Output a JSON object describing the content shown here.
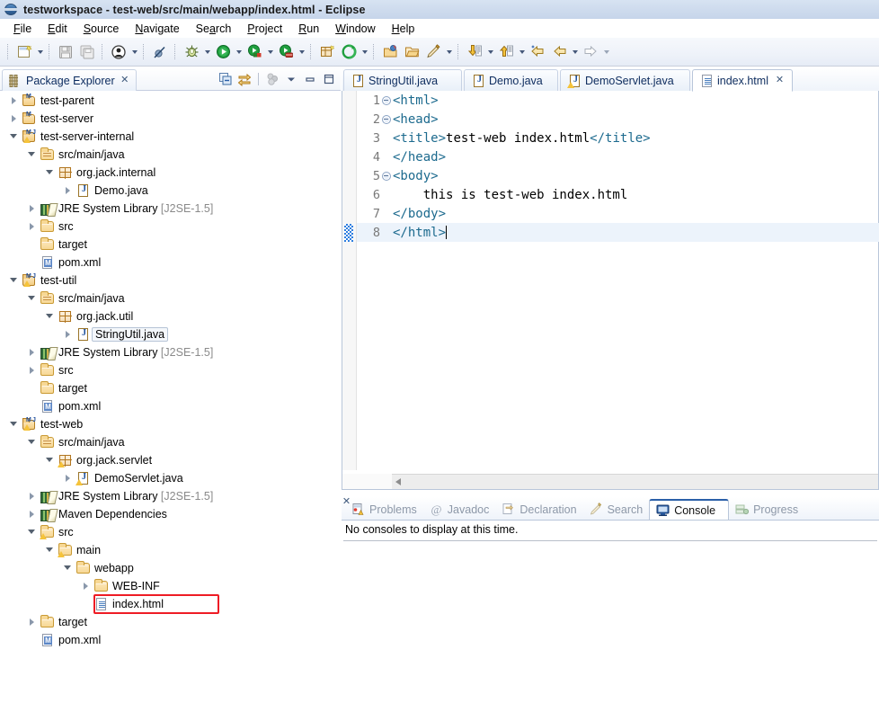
{
  "window": {
    "title": "testworkspace - test-web/src/main/webapp/index.html - Eclipse",
    "icon": "eclipse-globe-icon"
  },
  "menubar": {
    "items": [
      {
        "label": "File",
        "mnemonic": "F"
      },
      {
        "label": "Edit",
        "mnemonic": "E"
      },
      {
        "label": "Source",
        "mnemonic": "S"
      },
      {
        "label": "Navigate",
        "mnemonic": "N"
      },
      {
        "label": "Search",
        "mnemonic": "a"
      },
      {
        "label": "Project",
        "mnemonic": "P"
      },
      {
        "label": "Run",
        "mnemonic": "R"
      },
      {
        "label": "Window",
        "mnemonic": "W"
      },
      {
        "label": "Help",
        "mnemonic": "H"
      }
    ]
  },
  "toolbar": {
    "icons": [
      "new-wizard-icon",
      "save-icon",
      "save-all-icon",
      "user-icon",
      "skip-all-breakpoints-icon",
      "debug-icon",
      "run-icon",
      "run-external-tools-icon",
      "run-coverage-icon",
      "new-java-package-icon",
      "open-type-icon",
      "open-task-icon",
      "open-folder-icon",
      "search-icon",
      "next-annotation-icon",
      "previous-annotation-icon",
      "back-icon",
      "back-history-icon",
      "forward-icon"
    ]
  },
  "package_explorer": {
    "tab_label": "Package Explorer",
    "tab_icon": "package-explorer-icon",
    "close_icon": "close-icon",
    "tools": [
      "collapse-all-icon",
      "link-with-editor-icon",
      "focus-on-active-task-icon",
      "view-menu-icon",
      "minimize-icon",
      "maximize-icon"
    ],
    "tree": [
      {
        "depth": 0,
        "label": "test-parent",
        "icon": "maven-project-icon",
        "state": "collapsed"
      },
      {
        "depth": 0,
        "label": "test-server",
        "icon": "maven-project-icon",
        "state": "collapsed"
      },
      {
        "depth": 0,
        "label": "test-server-internal",
        "icon": "maven-java-project-warning-icon",
        "state": "expanded"
      },
      {
        "depth": 1,
        "label": "src/main/java",
        "icon": "source-folder-icon",
        "state": "expanded"
      },
      {
        "depth": 2,
        "label": "org.jack.internal",
        "icon": "package-icon",
        "state": "expanded"
      },
      {
        "depth": 3,
        "label": "Demo.java",
        "icon": "java-file-icon",
        "state": "collapsed"
      },
      {
        "depth": 1,
        "label": "JRE System Library",
        "suffix": "[J2SE-1.5]",
        "icon": "jre-library-icon",
        "state": "collapsed"
      },
      {
        "depth": 1,
        "label": "src",
        "icon": "folder-icon",
        "state": "collapsed"
      },
      {
        "depth": 1,
        "label": "target",
        "icon": "folder-icon",
        "state": "leaf"
      },
      {
        "depth": 1,
        "label": "pom.xml",
        "icon": "pom-file-icon",
        "state": "leaf"
      },
      {
        "depth": 0,
        "label": "test-util",
        "icon": "maven-java-project-warning-icon",
        "state": "expanded"
      },
      {
        "depth": 1,
        "label": "src/main/java",
        "icon": "source-folder-icon",
        "state": "expanded"
      },
      {
        "depth": 2,
        "label": "org.jack.util",
        "icon": "package-icon",
        "state": "expanded"
      },
      {
        "depth": 3,
        "label": "StringUtil.java",
        "icon": "java-file-icon",
        "state": "collapsed",
        "selected_outline": true
      },
      {
        "depth": 1,
        "label": "JRE System Library",
        "suffix": "[J2SE-1.5]",
        "icon": "jre-library-icon",
        "state": "collapsed"
      },
      {
        "depth": 1,
        "label": "src",
        "icon": "folder-icon",
        "state": "collapsed"
      },
      {
        "depth": 1,
        "label": "target",
        "icon": "folder-icon",
        "state": "leaf"
      },
      {
        "depth": 1,
        "label": "pom.xml",
        "icon": "pom-file-icon",
        "state": "leaf"
      },
      {
        "depth": 0,
        "label": "test-web",
        "icon": "maven-java-project-warning-icon",
        "state": "expanded"
      },
      {
        "depth": 1,
        "label": "src/main/java",
        "icon": "source-folder-icon",
        "state": "expanded"
      },
      {
        "depth": 2,
        "label": "org.jack.servlet",
        "icon": "package-warning-icon",
        "state": "expanded"
      },
      {
        "depth": 3,
        "label": "DemoServlet.java",
        "icon": "java-file-warning-icon",
        "state": "collapsed"
      },
      {
        "depth": 1,
        "label": "JRE System Library",
        "suffix": "[J2SE-1.5]",
        "icon": "jre-library-icon",
        "state": "collapsed"
      },
      {
        "depth": 1,
        "label": "Maven Dependencies",
        "icon": "jre-library-icon",
        "state": "collapsed"
      },
      {
        "depth": 1,
        "label": "src",
        "icon": "folder-warning-icon",
        "state": "expanded"
      },
      {
        "depth": 2,
        "label": "main",
        "icon": "folder-warning-icon",
        "state": "expanded"
      },
      {
        "depth": 3,
        "label": "webapp",
        "icon": "folder-icon",
        "state": "expanded"
      },
      {
        "depth": 4,
        "label": "WEB-INF",
        "icon": "folder-icon",
        "state": "collapsed"
      },
      {
        "depth": 4,
        "label": "index.html",
        "icon": "html-file-icon",
        "state": "leaf",
        "highlight": true
      },
      {
        "depth": 1,
        "label": "target",
        "icon": "folder-icon",
        "state": "collapsed"
      },
      {
        "depth": 1,
        "label": "pom.xml",
        "icon": "pom-file-icon",
        "state": "leaf"
      }
    ],
    "highlight_color": "#ee1c25"
  },
  "editor": {
    "tabs": [
      {
        "label": "StringUtil.java",
        "icon": "java-file-icon",
        "active": false
      },
      {
        "label": "Demo.java",
        "icon": "java-file-icon",
        "active": false
      },
      {
        "label": "DemoServlet.java",
        "icon": "java-file-warning-icon",
        "active": false
      },
      {
        "label": "index.html",
        "icon": "html-file-icon",
        "active": true,
        "close_icon": "close-icon"
      }
    ],
    "lines": [
      {
        "no": "1",
        "fold": true,
        "segments": [
          {
            "t": "tag",
            "s": "<html>"
          }
        ]
      },
      {
        "no": "2",
        "fold": true,
        "segments": [
          {
            "t": "tag",
            "s": "<head>"
          }
        ]
      },
      {
        "no": "3",
        "fold": false,
        "segments": [
          {
            "t": "tag",
            "s": "<title>"
          },
          {
            "t": "txt",
            "s": "test-web index.html"
          },
          {
            "t": "tag",
            "s": "</title>"
          }
        ]
      },
      {
        "no": "4",
        "fold": false,
        "segments": [
          {
            "t": "tag",
            "s": "</head>"
          }
        ]
      },
      {
        "no": "5",
        "fold": true,
        "segments": [
          {
            "t": "tag",
            "s": "<body>"
          }
        ]
      },
      {
        "no": "6",
        "fold": false,
        "segments": [
          {
            "t": "txt",
            "s": "    this is test-web index.html"
          }
        ]
      },
      {
        "no": "7",
        "fold": false,
        "segments": [
          {
            "t": "tag",
            "s": "</body>"
          }
        ]
      },
      {
        "no": "8",
        "fold": false,
        "current": true,
        "caret": true,
        "segments": [
          {
            "t": "tag",
            "s": "</html>"
          }
        ]
      }
    ],
    "scrollbar": {
      "name": "horizontal-scrollbar",
      "arrow": "scroll-left-arrow-icon"
    }
  },
  "bottom_panel": {
    "tabs": [
      {
        "label": "Problems",
        "icon": "problems-icon",
        "active": false
      },
      {
        "label": "Javadoc",
        "icon": "javadoc-icon",
        "active": false
      },
      {
        "label": "Declaration",
        "icon": "declaration-icon",
        "active": false
      },
      {
        "label": "Search",
        "icon": "search-icon",
        "active": false
      },
      {
        "label": "Console",
        "icon": "console-icon",
        "active": true,
        "close_icon": "close-icon"
      },
      {
        "label": "Progress",
        "icon": "progress-icon",
        "active": false
      }
    ],
    "console_message": "No consoles to display at this time."
  },
  "colors": {
    "title_bar": "#cfdcee",
    "accent": "#2a5fa8",
    "tag_color": "#1c6a8e",
    "current_line": "#ecf3fb",
    "annotation_red": "#ee1c25"
  }
}
